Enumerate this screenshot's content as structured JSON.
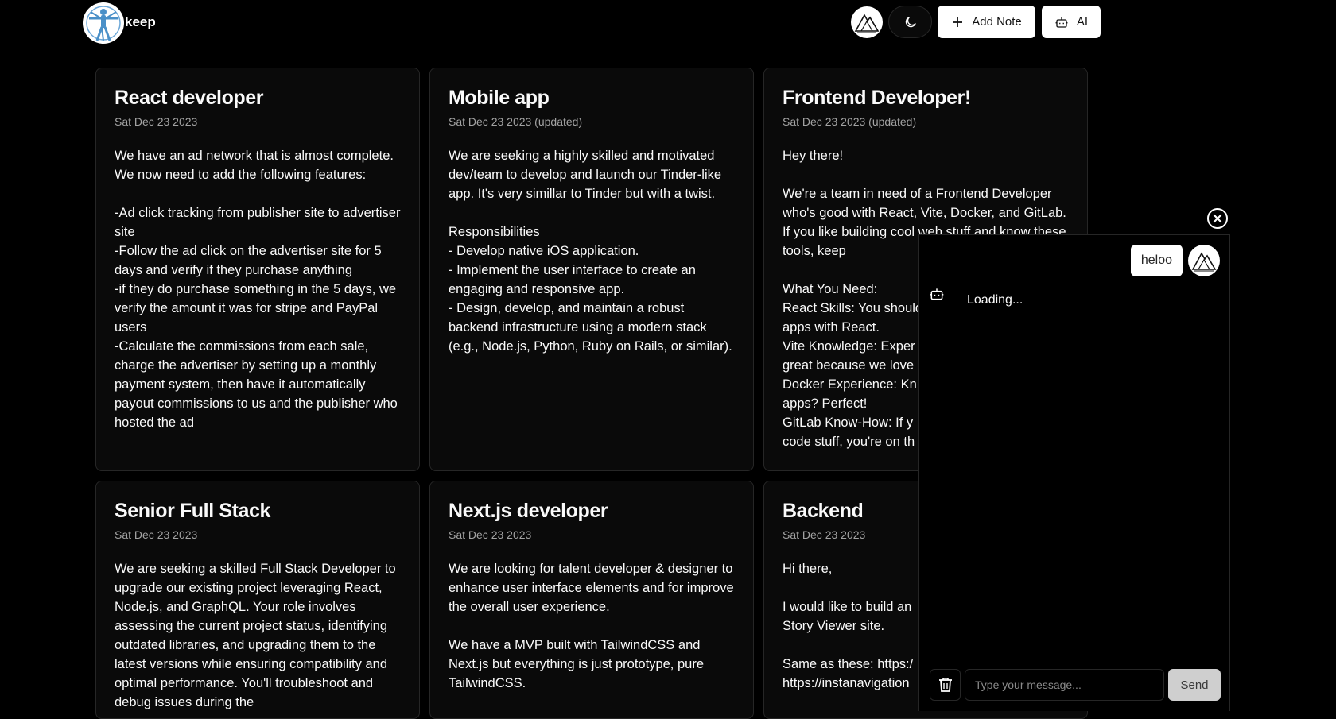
{
  "app": {
    "brand": "keep"
  },
  "header": {
    "add_note_label": "Add Note",
    "ai_label": "AI"
  },
  "notes": [
    {
      "title": "React developer",
      "date": "Sat Dec 23 2023",
      "body": "We have an ad network that is almost complete. We now need to add the following features:\n\n-Ad click tracking from publisher site to advertiser site\n-Follow the ad click on the advertiser site for 5 days and verify if they purchase anything\n-if they do purchase something in the 5 days, we verify the amount it was for stripe and PayPal users\n-Calculate the commissions from each sale, charge the advertiser by setting up a monthly payment system, then have it automatically payout commissions to us and the publisher who hosted the ad"
    },
    {
      "title": "Mobile app",
      "date": "Sat Dec 23 2023 (updated)",
      "body": "We are seeking a highly skilled and motivated dev/team to develop and launch our Tinder-like app. It's very simillar to Tinder but with a twist.\n\nResponsibilities\n- Develop native iOS application.\n- Implement the user interface to create an engaging and responsive app.\n- Design, develop, and maintain a robust backend infrastructure using a modern stack (e.g., Node.js, Python, Ruby on Rails, or similar)."
    },
    {
      "title": "Frontend Developer!",
      "date": "Sat Dec 23 2023 (updated)",
      "body": "Hey there!\n\nWe're a team in need of a Frontend Developer who's good with React, Vite, Docker, and GitLab. If you like building cool web stuff and know these tools, keep\n\nWhat You Need:\nReact Skills: You should\napps with React.\nVite Knowledge: Exper\ngreat because we love\nDocker Experience: Kn\napps? Perfect!\nGitLab Know-How: If y\ncode stuff, you're on th"
    },
    {
      "title": "Senior Full Stack",
      "date": "Sat Dec 23 2023",
      "body": "We are seeking a skilled Full Stack Developer to upgrade our existing project leveraging React, Node.js, and GraphQL. Your role involves assessing the current project status, identifying outdated libraries, and upgrading them to the latest versions while ensuring compatibility and optimal performance. You'll troubleshoot and debug issues during the"
    },
    {
      "title": "Next.js developer",
      "date": "Sat Dec 23 2023",
      "body": "We are looking for talent developer & designer to enhance user interface elements and for improve the overall user experience.\n\nWe have a MVP built with TailwindCSS and Next.js but everything is just prototype, pure TailwindCSS."
    },
    {
      "title": "Backend",
      "date": "Sat Dec 23 2023",
      "body": "Hi there,\n\nI would like to build an\nStory Viewer site.\n\nSame as these: https:/\nhttps://instanavigation"
    }
  ],
  "chat": {
    "user_message": "heloo",
    "bot_status": "Loading...",
    "input_placeholder": "Type your message...",
    "send_label": "Send"
  },
  "colors": {
    "background": "#000000",
    "card_bg": "#0a0a0a",
    "border": "#262626",
    "muted_text": "#a3a3a3",
    "button_light": "#ffffff"
  }
}
